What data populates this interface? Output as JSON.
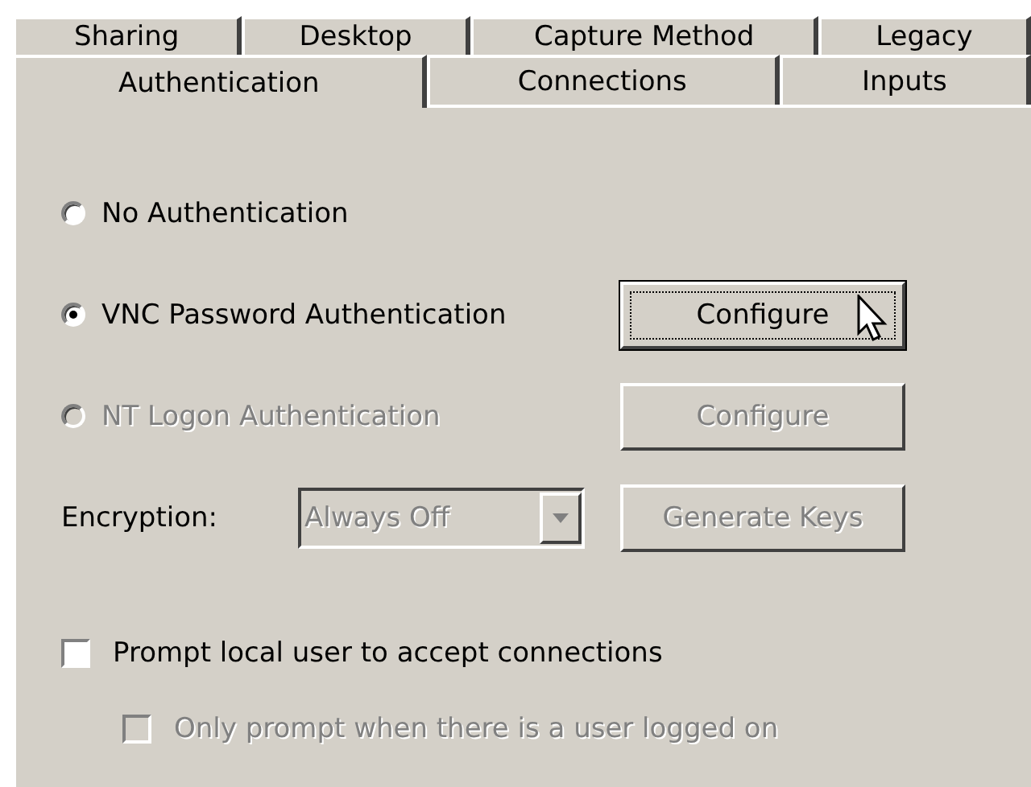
{
  "tab_rows": [
    {
      "tabs": [
        {
          "label": "Sharing",
          "selected": false
        },
        {
          "label": "Desktop",
          "selected": false
        },
        {
          "label": "Capture Method",
          "selected": false
        },
        {
          "label": "Legacy",
          "selected": false
        }
      ]
    },
    {
      "tabs": [
        {
          "label": "Authentication",
          "selected": true
        },
        {
          "label": "Connections",
          "selected": false
        },
        {
          "label": "Inputs",
          "selected": false
        }
      ]
    }
  ],
  "auth_options": [
    {
      "label": "No Authentication",
      "selected": false,
      "disabled": false
    },
    {
      "label": "VNC Password Authentication",
      "selected": true,
      "disabled": false,
      "button": {
        "label": "Configure",
        "disabled": false,
        "focused": true
      }
    },
    {
      "label": "NT Logon Authentication",
      "selected": false,
      "disabled": true,
      "button": {
        "label": "Configure",
        "disabled": true,
        "focused": false
      }
    }
  ],
  "encryption": {
    "label": "Encryption:",
    "value": "Always Off",
    "disabled": true,
    "button": {
      "label": "Generate Keys",
      "disabled": true,
      "focused": false
    }
  },
  "checkboxes": [
    {
      "label": "Prompt local user to accept connections",
      "checked": false,
      "disabled": false,
      "children": [
        {
          "label": "Only prompt when there is a user logged on",
          "checked": false,
          "disabled": true
        }
      ]
    }
  ]
}
